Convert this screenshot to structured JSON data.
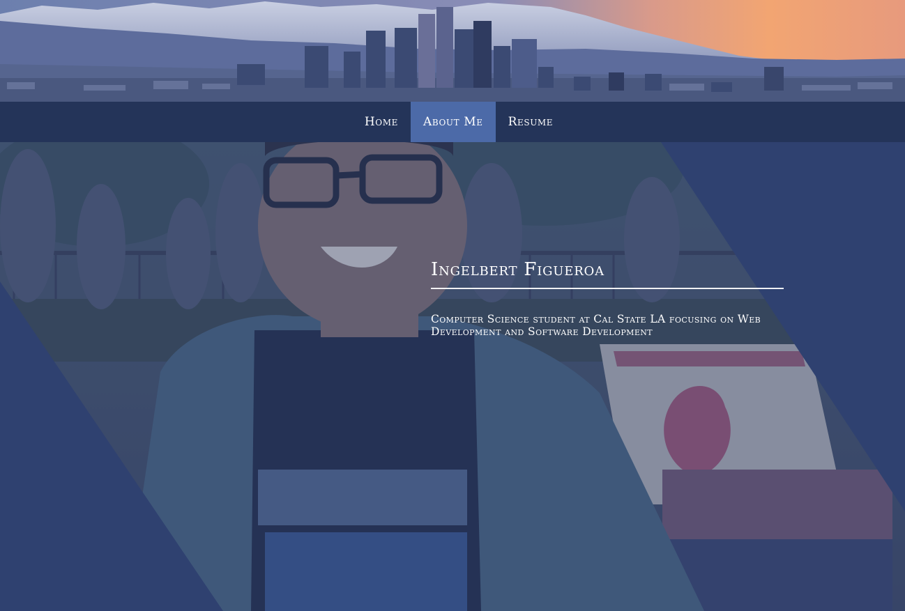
{
  "nav": {
    "items": [
      {
        "label": "Home",
        "active": false
      },
      {
        "label": "About Me",
        "active": true
      },
      {
        "label": "Resume",
        "active": false
      }
    ]
  },
  "profile": {
    "name": "Ingelbert Figueroa",
    "tagline": "Computer Science student at Cal State LA focusing on Web Development and Software Development"
  },
  "colors": {
    "navbar": "#243458",
    "nav_active": "#4c6aa8",
    "overlay": "#2e4068",
    "text": "#ffffff"
  }
}
